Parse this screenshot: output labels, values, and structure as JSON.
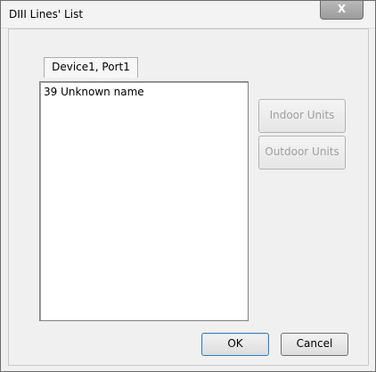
{
  "window": {
    "title": "DIII Lines' List",
    "close_label": "X"
  },
  "tab": {
    "label": "Device1, Port1"
  },
  "list": {
    "items": [
      "39  Unknown name"
    ]
  },
  "side_buttons": {
    "indoor": "Indoor Units",
    "outdoor": "Outdoor Units"
  },
  "footer": {
    "ok": "OK",
    "cancel": "Cancel"
  }
}
